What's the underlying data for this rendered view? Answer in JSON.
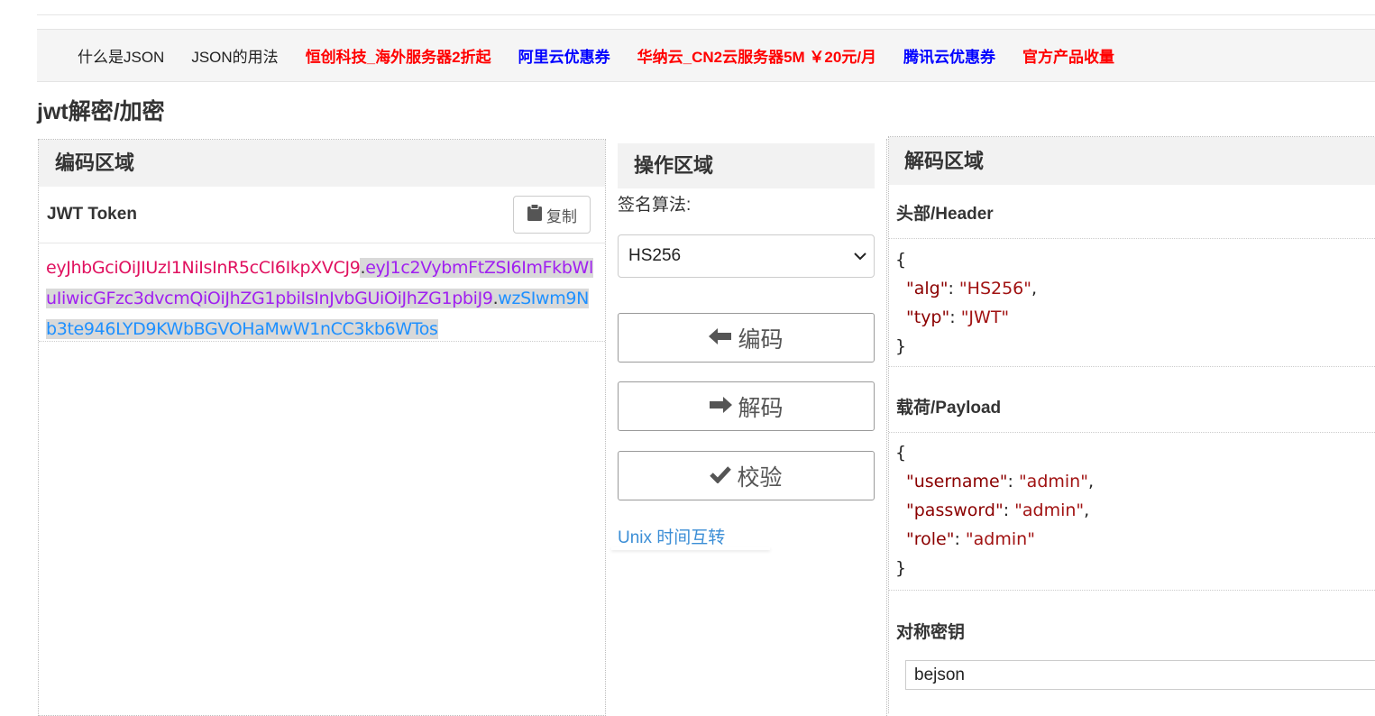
{
  "nav": {
    "items": [
      {
        "label": "什么是JSON",
        "color": "#222222",
        "bold": false
      },
      {
        "label": "JSON的用法",
        "color": "#222222",
        "bold": false
      },
      {
        "label": "恒创科技_海外服务器2折起",
        "color": "#ff0000",
        "bold": true
      },
      {
        "label": "阿里云优惠券",
        "color": "#0000ff",
        "bold": true
      },
      {
        "label": "华纳云_CN2云服务器5M ￥20元/月",
        "color": "#ff0000",
        "bold": true
      },
      {
        "label": "腾讯云优惠券",
        "color": "#0000ff",
        "bold": true
      },
      {
        "label": "官方产品收量",
        "color": "#ff0000",
        "bold": true
      }
    ]
  },
  "page_title": "jwt解密/加密",
  "encode": {
    "title": "编码区域",
    "jwt_label": "JWT Token",
    "copy_label": "复制",
    "copy_icon": "clipboard-icon",
    "token": {
      "header": "eyJhbGciOiJIUzI1NiIsInR5cCI6IkpXVCJ9",
      "dot1": ".",
      "payload": "eyJ1c2VybmFtZSI6ImFkbWluIiwicGFzc3dvcmQiOiJhZG1pbiIsInJvbGUiOiJhZG1pbiJ9",
      "dot2": ".",
      "signature": "wzSIwm9Nb3te946LYD9KWbBGVOHaMwW1nCC3kb6WTos"
    },
    "colors": {
      "header": "#e0115f",
      "payload": "#a020f0",
      "signature": "#1e90ff"
    }
  },
  "ops": {
    "title": "操作区域",
    "algo_label": "签名算法:",
    "algo_selected": "HS256",
    "encode_label": "编码",
    "encode_icon": "arrow-left-icon",
    "decode_label": "解码",
    "decode_icon": "arrow-right-icon",
    "verify_label": "校验",
    "verify_icon": "checkmark-icon",
    "unix_link": "Unix 时间互转"
  },
  "decode": {
    "title": "解码区域",
    "header_label": "头部/Header",
    "header_json": {
      "open": "{",
      "close": "}",
      "fields": [
        {
          "key": "\"alg\"",
          "value": "\"HS256\"",
          "comma": ","
        },
        {
          "key": "\"typ\"",
          "value": "\"JWT\"",
          "comma": ""
        }
      ]
    },
    "payload_label": "载荷/Payload",
    "payload_json": {
      "open": "{",
      "close": "}",
      "fields": [
        {
          "key": "\"username\"",
          "value": "\"admin\"",
          "comma": ","
        },
        {
          "key": "\"password\"",
          "value": "\"admin\"",
          "comma": ","
        },
        {
          "key": "\"role\"",
          "value": "\"admin\"",
          "comma": ""
        }
      ]
    },
    "secret_label": "对称密钥",
    "secret_value": "bejson"
  }
}
